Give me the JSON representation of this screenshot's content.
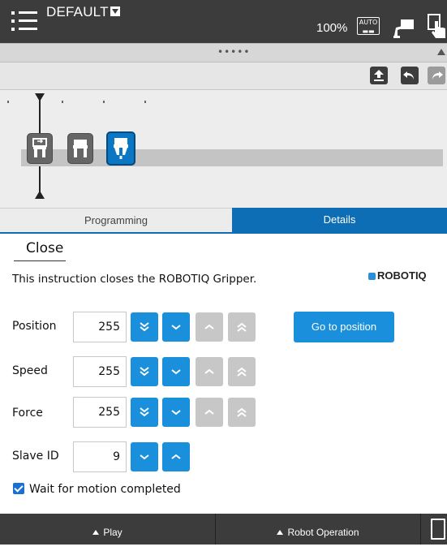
{
  "header": {
    "program_name": "DEFAULT",
    "speed": "100%",
    "auto_label": "AUTO"
  },
  "tabs": [
    {
      "label": "Programming",
      "active": false
    },
    {
      "label": "Details",
      "active": true
    }
  ],
  "details": {
    "title": "Close",
    "description": "This instruction closes the ROBOTIQ Gripper.",
    "logo": "ROBOTIQ",
    "position": {
      "label": "Position",
      "value": "255"
    },
    "speed": {
      "label": "Speed",
      "value": "255"
    },
    "force": {
      "label": "Force",
      "value": "255"
    },
    "slave_id": {
      "label": "Slave ID",
      "value": "9"
    },
    "go_to_position": "Go to position",
    "wait_label": "Wait for motion completed",
    "wait_checked": true
  },
  "footer": {
    "play": "Play",
    "robot_operation": "Robot Operation"
  },
  "colors": {
    "accent": "#1a8fdc",
    "tab_active": "#0d6eb5",
    "bar": "#3c3c3c"
  }
}
